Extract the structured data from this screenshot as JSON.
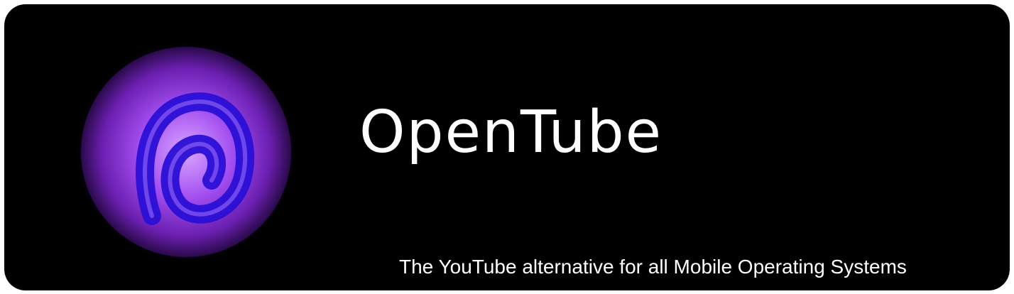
{
  "banner": {
    "title": "OpenTube",
    "tagline": "The YouTube alternative for all Mobile Operating Systems",
    "logo_icon": "opentube-logo-icon"
  },
  "colors": {
    "background": "#000000",
    "text": "#ffffff",
    "logo_outer": "#8a2be2",
    "logo_inner": "#c77dff",
    "logo_stroke": "#2a0fd6"
  }
}
